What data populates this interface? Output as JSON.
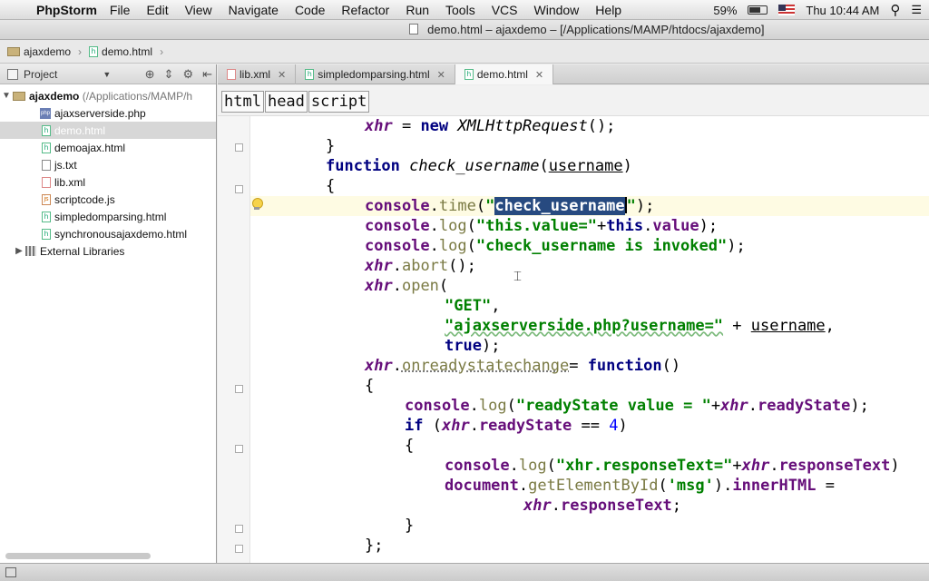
{
  "menubar": {
    "apple": "",
    "app_name": "PhpStorm",
    "items": [
      "File",
      "Edit",
      "View",
      "Navigate",
      "Code",
      "Refactor",
      "Run",
      "Tools",
      "VCS",
      "Window",
      "Help"
    ],
    "battery": "59%",
    "clock": "Thu 10:44 AM"
  },
  "window": {
    "title": "demo.html – ajaxdemo – [/Applications/MAMP/htdocs/ajaxdemo]"
  },
  "navbar": {
    "project": "ajaxdemo",
    "file": "demo.html"
  },
  "project_panel": {
    "title": "Project",
    "root": "ajaxdemo",
    "root_path": "(/Applications/MAMP/h",
    "files": [
      {
        "name": "ajaxserverside.php",
        "type": "php"
      },
      {
        "name": "demo.html",
        "type": "html",
        "selected": true
      },
      {
        "name": "demoajax.html",
        "type": "html"
      },
      {
        "name": "js.txt",
        "type": "txt"
      },
      {
        "name": "lib.xml",
        "type": "xml"
      },
      {
        "name": "scriptcode.js",
        "type": "js"
      },
      {
        "name": "simpledomparsing.html",
        "type": "html"
      },
      {
        "name": "synchronousajaxdemo.html",
        "type": "html"
      }
    ],
    "external": "External Libraries"
  },
  "tabs": [
    {
      "label": "lib.xml",
      "active": false
    },
    {
      "label": "simpledomparsing.html",
      "active": false
    },
    {
      "label": "demo.html",
      "active": true
    }
  ],
  "tag_breadcrumb": [
    "html",
    "head",
    "script"
  ],
  "code": {
    "l1_var": "xhr",
    "l1_rest": " = ",
    "l1_new": "new",
    "l1_cls": "XMLHttpRequest",
    "l1_end": "();",
    "l2": "}",
    "l3_kw": "function",
    "l3_name": "check_username",
    "l3_param": "username",
    "l4": "{",
    "l5_obj": "console",
    "l5_fn": "time",
    "l5_sel": "check_username",
    "l6_obj": "console",
    "l6_fn": "log",
    "l6_str": "\"this.value=\"",
    "l6_this": "this",
    "l6_prop": "value",
    "l7_obj": "console",
    "l7_fn": "log",
    "l7_str": "\"check_username is invoked\"",
    "l8_var": "xhr",
    "l8_fn": "abort",
    "l9_var": "xhr",
    "l9_fn": "open",
    "l10_str": "\"GET\"",
    "l11_str": "\"ajaxserverside.php?username=\"",
    "l11_var": "username",
    "l12_kw": "true",
    "l13_var": "xhr",
    "l13_prop": "onreadystatechange",
    "l13_kw": "function",
    "l14": "{",
    "l15_obj": "console",
    "l15_fn": "log",
    "l15_str": "\"readyState value = \"",
    "l15_var": "xhr",
    "l15_prop": "readyState",
    "l16_kw": "if",
    "l16_var": "xhr",
    "l16_prop": "readyState",
    "l16_num": "4",
    "l17": "{",
    "l18_obj": "console",
    "l18_fn": "log",
    "l18_str": "\"xhr.responseText=\"",
    "l18_var": "xhr",
    "l18_prop": "responseText",
    "l19_obj": "document",
    "l19_fn": "getElementById",
    "l19_str": "'msg'",
    "l19_prop": "innerHTML",
    "l20_var": "xhr",
    "l20_prop": "responseText",
    "l21": "}",
    "l22": "};"
  }
}
